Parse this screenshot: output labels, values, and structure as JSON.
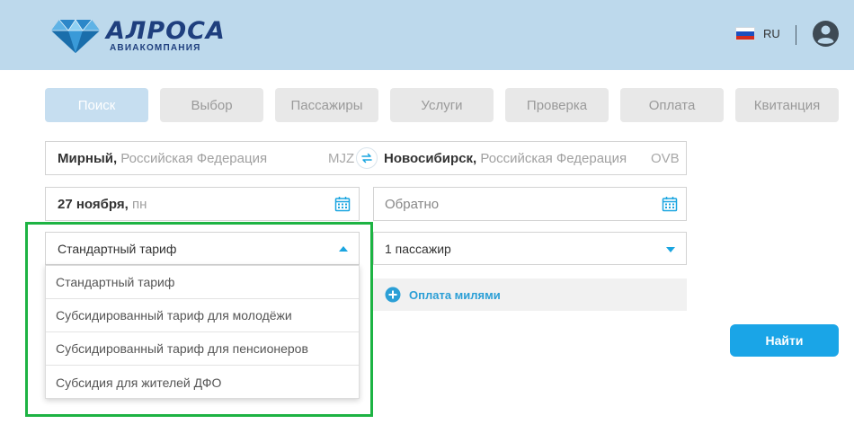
{
  "header": {
    "logo_name": "АЛРОСА",
    "logo_sub": "АВИАКОМПАНИЯ",
    "language": "RU",
    "flag_colors": [
      "#ffffff",
      "#1c4fbf",
      "#d52b1e"
    ],
    "brand_color": "#1f3f7e",
    "background": "#bdd9ec"
  },
  "steps": [
    {
      "label": "Поиск",
      "active": true
    },
    {
      "label": "Выбор",
      "active": false
    },
    {
      "label": "Пассажиры",
      "active": false
    },
    {
      "label": "Услуги",
      "active": false
    },
    {
      "label": "Проверка",
      "active": false
    },
    {
      "label": "Оплата",
      "active": false
    },
    {
      "label": "Квитанция",
      "active": false
    }
  ],
  "route": {
    "from_city": "Мирный,",
    "from_country": " Российская Федерация",
    "from_code": "MJZ",
    "to_city": "Новосибирск,",
    "to_country": " Российская Федерация",
    "to_code": "OVB"
  },
  "date": {
    "day": "27 ноября,",
    "weekday": " пн",
    "return_placeholder": "Обратно"
  },
  "tariff": {
    "selected": "Стандартный тариф",
    "options": [
      "Стандартный тариф",
      "Субсидированный тариф для молодёжи",
      "Субсидированный тариф для пенсионеров",
      "Субсидия для жителей ДФО"
    ]
  },
  "passengers": "1 пассажир",
  "miles_label": "Оплата милями",
  "find_button": "Найти",
  "colors": {
    "accent": "#1aa5e7",
    "highlight": "#1db343",
    "active_step": "#c6def0"
  }
}
